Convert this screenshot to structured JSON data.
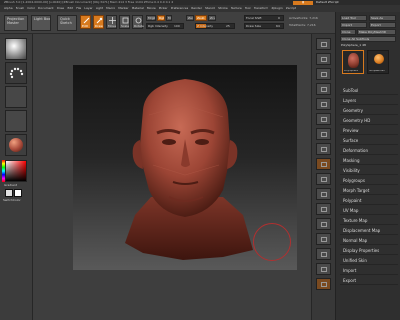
{
  "titlebar": {
    "text": "ZBrush 3.0 [1-2004-0000-09] [v.0040] [ZBrush Document]   [Obj:3471] Mem:414 3 Free 1104 ZTime:0.4 0.0 0.1 4",
    "right_label": "Default ZScript"
  },
  "menubar": [
    "Alpha",
    "Brush",
    "Color",
    "Document",
    "Draw",
    "Edit",
    "File",
    "Layer",
    "Light",
    "Macro",
    "Marker",
    "Material",
    "Movie",
    "Picker",
    "Preferences",
    "Render",
    "Stencil",
    "Stroke",
    "Texture",
    "Tool",
    "Transform",
    "Zplugin",
    "Zscript"
  ],
  "toolbar": {
    "projection_master": "Projection Master",
    "lightbox": "Light Box",
    "quick_sketch": "Quick Sketch",
    "edit": "Edit",
    "draw": "Draw",
    "move": "Move",
    "scale": "Scale",
    "rotate": "Rotate",
    "mrgb": "Mrgb",
    "rgb": "Rgb",
    "m": "M",
    "rgb_intensity_label": "Rgb Intensity",
    "rgb_intensity_value": "100",
    "zadd": "Zadd",
    "zsub": "Zsub",
    "zcut": "Zcut",
    "z_intensity_label": "Z Intensity",
    "z_intensity_value": "25",
    "focal_shift_label": "Focal Shift",
    "focal_shift_value": "0",
    "draw_size_label": "Draw Size",
    "draw_size_value": "64",
    "activepoints": "ActivePoints: 7,216",
    "totalpoints": "TotalPoints: 7,216"
  },
  "leftshelf": {
    "gradient_label": "Gradient",
    "switch_color_label": "SwitchColor",
    "colors": {
      "main": "#ff0000",
      "secondary": "#ffffff",
      "accent": "#d87a1e",
      "material": "#a84a3a"
    }
  },
  "palette": {
    "top_buttons": [
      "Load Tool",
      "Save As",
      "Import",
      "Export",
      "Clone",
      "Make PolyMesh3D",
      "Clone All SubTools"
    ],
    "polysphere_label": "PolySphere_1  48",
    "thumbs": [
      "PolySphere",
      "SimpleBrush"
    ],
    "items": [
      "SubTool",
      "Layers",
      "Geometry",
      "Geometry HD",
      "Preview",
      "Surface",
      "Deformation",
      "Masking",
      "Visibility",
      "Polygroups",
      "Morph Target",
      "Polypaint",
      "UV Map",
      "Texture Map",
      "Displacement Map",
      "Normal Map",
      "Display Properties",
      "Unified Skin",
      "Import",
      "Export"
    ]
  },
  "rightshelf": {
    "buttons": [
      "Scroll",
      "Zoom",
      "Actual",
      "AAHalf",
      "Persp",
      "Floor",
      "Local",
      "XYZ",
      "Frame",
      "Move",
      "Scale",
      "Rotate",
      "PolyF",
      "Transp",
      "Ghost",
      "Solo",
      "Xpose"
    ]
  }
}
